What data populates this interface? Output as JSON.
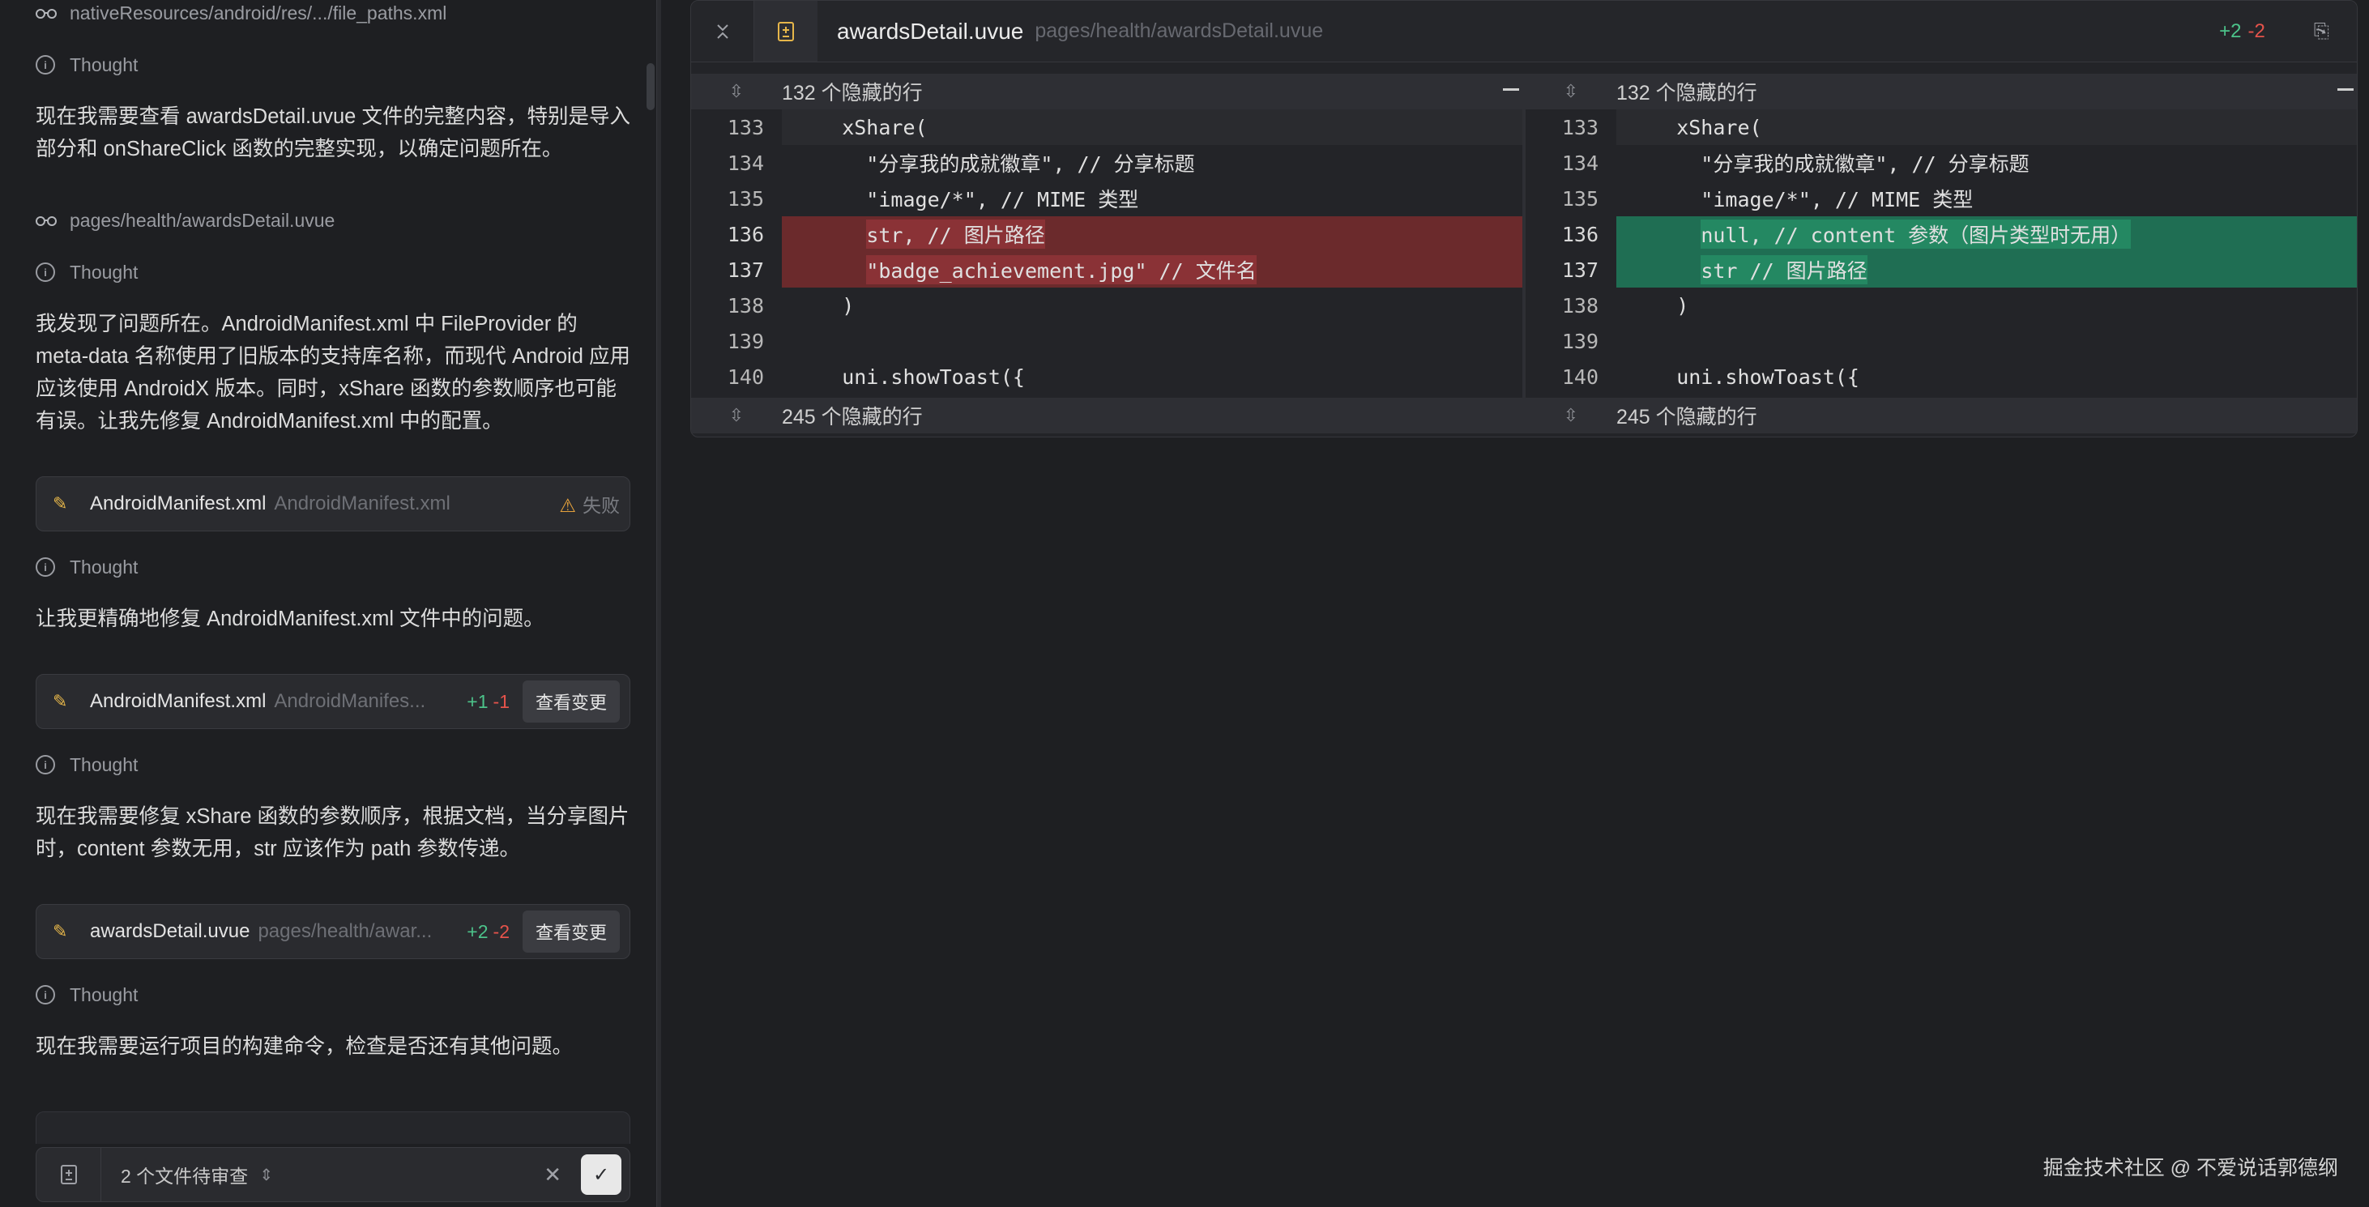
{
  "chat": {
    "file_ref_top": "nativeResources/android/res/.../file_paths.xml",
    "thought_label": "Thought",
    "msg1": "现在我需要查看 awardsDetail.uvue 文件的完整内容，特别是导入部分和 onShareClick 函数的完整实现，以确定问题所在。",
    "file_ref_2": "pages/health/awardsDetail.uvue",
    "msg2": "我发现了问题所在。AndroidManifest.xml 中 FileProvider 的 meta-data 名称使用了旧版本的支持库名称，而现代 Android 应用应该使用 AndroidX 版本。同时，xShare 函数的参数顺序也可能有误。让我先修复 AndroidManifest.xml 中的配置。",
    "card1": {
      "name": "AndroidManifest.xml",
      "path": "AndroidManifest.xml",
      "status": "失败"
    },
    "msg3": "让我更精确地修复 AndroidManifest.xml 文件中的问题。",
    "card2": {
      "name": "AndroidManifest.xml",
      "path": "AndroidManifes...",
      "adds": "+1",
      "dels": "-1",
      "button": "查看变更"
    },
    "msg4": "现在我需要修复 xShare 函数的参数顺序，根据文档，当分享图片时，content 参数无用，str 应该作为 path 参数传递。",
    "card3": {
      "name": "awardsDetail.uvue",
      "path": "pages/health/awar...",
      "adds": "+2",
      "dels": "-2",
      "button": "查看变更"
    },
    "msg5": "现在我需要运行项目的构建命令，检查是否还有其他问题。"
  },
  "review_bar": {
    "pending": "2 个文件待审查"
  },
  "diff": {
    "filename": "awardsDetail.uvue",
    "path": "pages/health/awardsDetail.uvue",
    "adds": "+2",
    "dels": "-2",
    "hidden_top": "132 个隐藏的行",
    "hidden_bottom": "245 个隐藏的行",
    "left_lines": [
      {
        "n": "133",
        "pre": "    xShare(",
        "hl": "",
        "post": ""
      },
      {
        "n": "134",
        "pre": "      \"分享我的成就徽章\", // 分享标题",
        "hl": "",
        "post": ""
      },
      {
        "n": "135",
        "pre": "      \"image/*\", // MIME 类型",
        "hl": "",
        "post": ""
      },
      {
        "n": "136",
        "pre": "      ",
        "hl": "str, // 图片路径",
        "post": ""
      },
      {
        "n": "137",
        "pre": "      ",
        "hl": "\"badge_achievement.jpg\" // 文件名",
        "post": ""
      },
      {
        "n": "138",
        "pre": "    )",
        "hl": "",
        "post": ""
      },
      {
        "n": "139",
        "pre": "",
        "hl": "",
        "post": ""
      },
      {
        "n": "140",
        "pre": "    uni.showToast({",
        "hl": "",
        "post": ""
      }
    ],
    "right_lines": [
      {
        "n": "133",
        "pre": "    xShare(",
        "hl": "",
        "post": ""
      },
      {
        "n": "134",
        "pre": "      \"分享我的成就徽章\", // 分享标题",
        "hl": "",
        "post": ""
      },
      {
        "n": "135",
        "pre": "      \"image/*\", // MIME 类型",
        "hl": "",
        "post": ""
      },
      {
        "n": "136",
        "pre": "      ",
        "hl": "null, // content 参数（图片类型时无用）",
        "post": ""
      },
      {
        "n": "137",
        "pre": "      ",
        "hl": "str // 图片路径",
        "post": ""
      },
      {
        "n": "138",
        "pre": "    )",
        "hl": "",
        "post": ""
      },
      {
        "n": "139",
        "pre": "",
        "hl": "",
        "post": ""
      },
      {
        "n": "140",
        "pre": "    uni.showToast({",
        "hl": "",
        "post": ""
      }
    ]
  },
  "watermark": "掘金技术社区 @ 不爱说话郭德纲",
  "colors": {
    "added": "#1f6e53",
    "removed": "#6b2a2c",
    "accent_yellow": "#e6b64a",
    "plus_green": "#4cc38a",
    "minus_red": "#e5534b"
  },
  "icons": [
    "glasses-icon",
    "thought-icon",
    "edit-icon",
    "warning-icon",
    "file-diff-icon",
    "collapse-icon",
    "copy-icon",
    "expand-icon",
    "close-icon",
    "check-icon",
    "chevron-updown-icon"
  ]
}
